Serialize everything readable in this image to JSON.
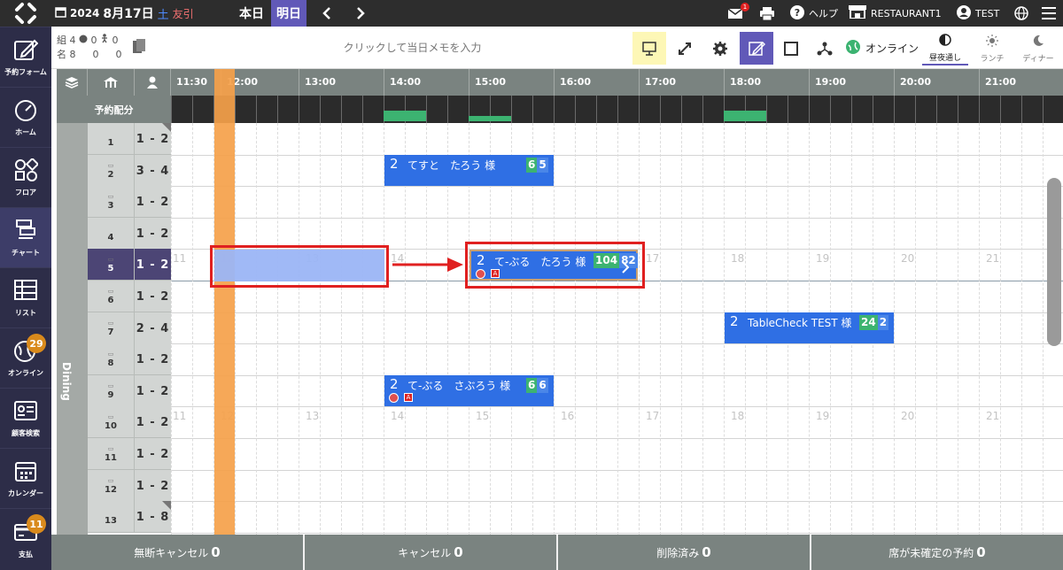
{
  "header": {
    "year": "2024",
    "month_day": "8月17日",
    "day_of_week": "土",
    "rokuyo": "友引",
    "today": "本日",
    "tomorrow": "明日",
    "notification_count": "1",
    "help": "ヘルプ",
    "restaurant": "RESTAURANT1",
    "user": "TEST"
  },
  "sidebar": {
    "items": [
      {
        "label": "予約フォーム",
        "icon": "pencil-square-icon"
      },
      {
        "label": "ホーム",
        "icon": "gauge-icon"
      },
      {
        "label": "フロア",
        "icon": "shapes-icon"
      },
      {
        "label": "チャート",
        "icon": "chart-bars-icon"
      },
      {
        "label": "リスト",
        "icon": "table-icon"
      },
      {
        "label": "オンライン",
        "icon": "globe-icon",
        "badge": "29"
      },
      {
        "label": "顧客検索",
        "icon": "id-card-icon"
      },
      {
        "label": "カレンダー",
        "icon": "calendar-icon"
      },
      {
        "label": "支払",
        "icon": "credit-card-icon",
        "badge": "11"
      }
    ]
  },
  "toolbar": {
    "counts_row1": [
      "組",
      "4",
      "0",
      "0"
    ],
    "counts_row2": [
      "名",
      "8",
      "0",
      "0"
    ],
    "memo_placeholder": "クリックして当日メモを入力",
    "online_label": "オンライン",
    "modes": [
      {
        "label": "昼夜通し",
        "icon": "half-circle-icon"
      },
      {
        "label": "ランチ",
        "icon": "sun-icon"
      },
      {
        "label": "ディナー",
        "icon": "moon-icon"
      }
    ]
  },
  "chart": {
    "hours": [
      "11:30",
      "12:00",
      "13:00",
      "14:00",
      "15:00",
      "16:00",
      "17:00",
      "18:00",
      "19:00",
      "20:00",
      "21:00"
    ],
    "alloc_label": "予約配分",
    "area_label": "Dining",
    "ghost_hours": [
      "11",
      "12",
      "13",
      "14",
      "15",
      "16",
      "17",
      "18",
      "19",
      "20",
      "21"
    ],
    "tables": [
      {
        "name": "1",
        "cap": "1 - 2"
      },
      {
        "name": "2",
        "cap": "3 - 4"
      },
      {
        "name": "3",
        "cap": "1 - 2"
      },
      {
        "name": "4",
        "cap": "1 - 2"
      },
      {
        "name": "5",
        "cap": "1 - 2"
      },
      {
        "name": "6",
        "cap": "1 - 2"
      },
      {
        "name": "7",
        "cap": "2 - 4"
      },
      {
        "name": "8",
        "cap": "1 - 2"
      },
      {
        "name": "9",
        "cap": "1 - 2"
      },
      {
        "name": "10",
        "cap": "1 - 2"
      },
      {
        "name": "11",
        "cap": "1 - 2"
      },
      {
        "name": "12",
        "cap": "1 - 2"
      },
      {
        "name": "13",
        "cap": "1 - 8"
      }
    ],
    "reservations": [
      {
        "party": "2",
        "name": "てすと　たろう 様",
        "tag1": "6",
        "tag2": "5"
      },
      {
        "party": "2",
        "name": "て-ぶる　たろう 様",
        "tag1": "104",
        "tag2": "82"
      },
      {
        "party": "2",
        "name": "TableCheck TEST 様",
        "tag1": "24",
        "tag2": "2"
      },
      {
        "party": "2",
        "name": "て-ぶる　さぶろう 様",
        "tag1": "6",
        "tag2": "6"
      }
    ]
  },
  "footer": {
    "items": [
      {
        "label": "無断キャンセル",
        "count": "0"
      },
      {
        "label": "キャンセル",
        "count": "0"
      },
      {
        "label": "削除済み",
        "count": "0"
      },
      {
        "label": "席が未確定の予約",
        "count": "0"
      }
    ]
  },
  "colors": {
    "sidebar": "#2d2d48",
    "accent_purple": "#6159b8",
    "reservation_blue": "#2f6fe4",
    "current_time": "#f5a14a",
    "highlight_red": "#e02020"
  }
}
